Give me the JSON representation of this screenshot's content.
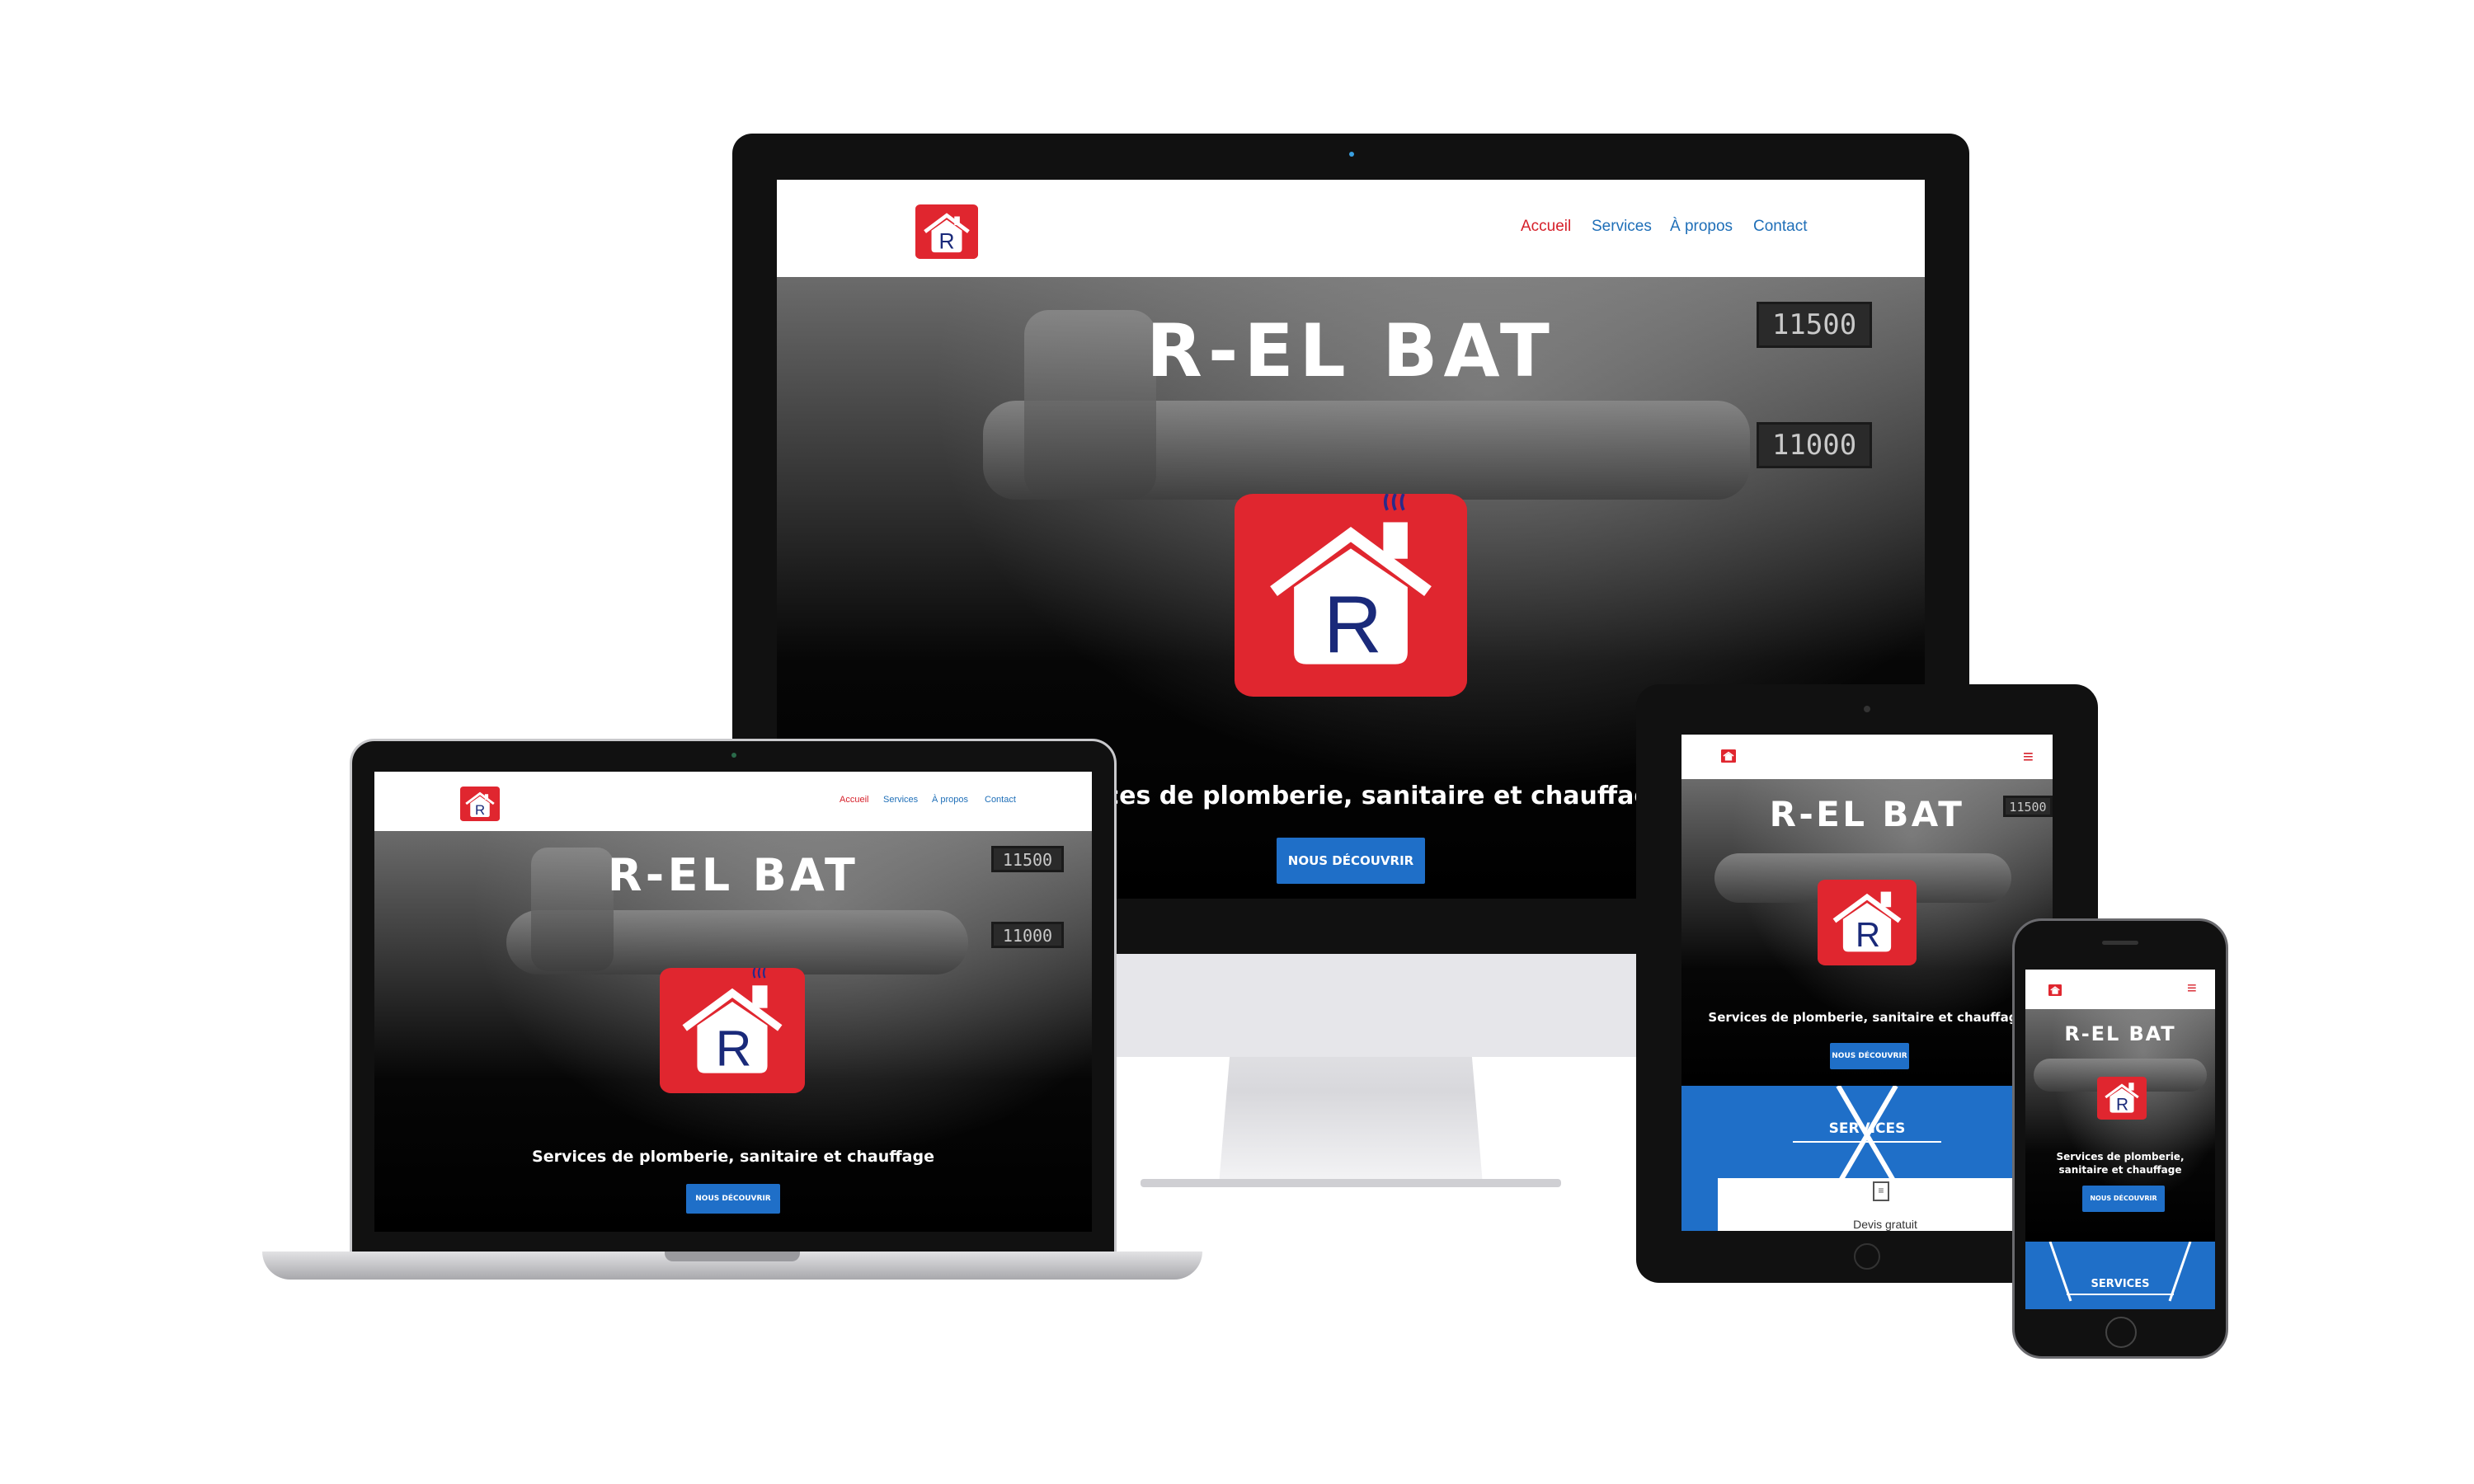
{
  "brand": {
    "name": "R-EL BAT",
    "logo_letter": "R",
    "red": "#e0262f",
    "blue": "#1f6fc8",
    "navy": "#1a2a7a"
  },
  "nav": {
    "items": [
      {
        "label": "Accueil",
        "active": true
      },
      {
        "label": "Services",
        "active": false
      },
      {
        "label": "À propos",
        "active": false
      },
      {
        "label": "Contact",
        "active": false
      }
    ]
  },
  "hero": {
    "title": "R-EL BAT",
    "subtitle": "Services de plomberie, sanitaire et chauffage",
    "subtitle_desktop_visible": "vices de plomberie, sanitaire et chauffage",
    "subtitle_tablet_visible": "Services de plomberie, sanitaire et chauffag",
    "subtitle_phone_line1": "Services de plomberie,",
    "subtitle_phone_line2": "sanitaire et chauffage",
    "cta": "NOUS DÉCOUVRIR",
    "gauge_1": "11500",
    "gauge_2": "11000"
  },
  "sections": {
    "services_title": "SERVICES",
    "service_card_1": "Devis gratuit"
  },
  "icons": {
    "logo": "house-logo-icon",
    "menu": "hamburger-menu-icon",
    "document": "document-icon"
  }
}
